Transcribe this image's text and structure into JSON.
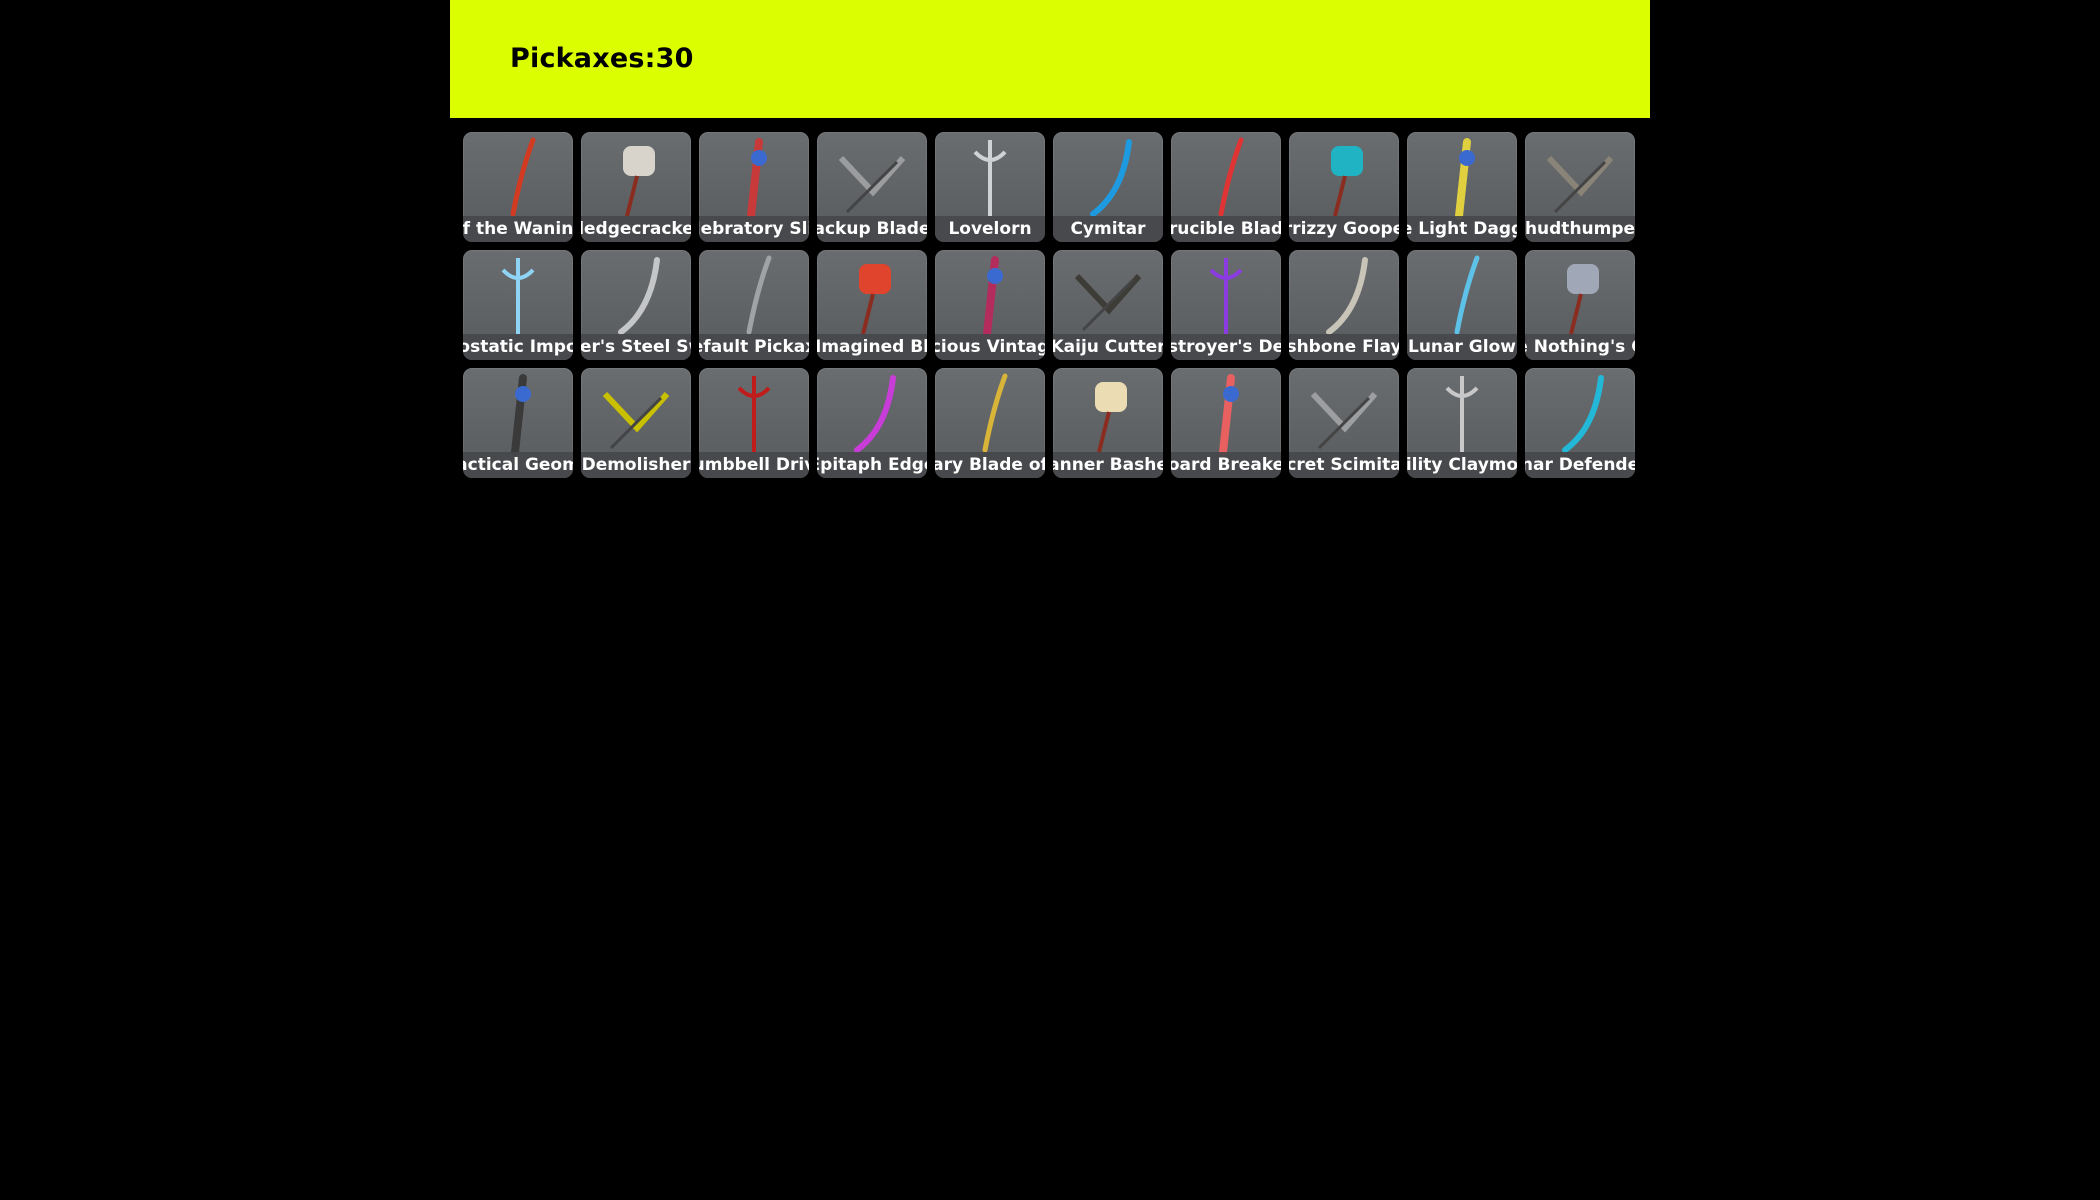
{
  "header": {
    "title": "Pickaxes:30"
  },
  "colors": {
    "header_bg": "#dbff00",
    "page_bg": "#000000",
    "tile_bg": "#5f6265"
  },
  "items": [
    {
      "label": "f the Wanin",
      "icon": "red-scythe-blade-icon",
      "color": "#d23a22"
    },
    {
      "label": "ledgecracke",
      "icon": "sledgehammer-icon",
      "color": "#d8d4cc"
    },
    {
      "label": "lebratory Sli",
      "icon": "confetti-popper-icon",
      "color": "#c83a3a"
    },
    {
      "label": "ackup Blade",
      "icon": "crossed-axes-icon",
      "color": "#9a9c9e"
    },
    {
      "label": "Lovelorn",
      "icon": "silver-trident-icon",
      "color": "#d0d2d4"
    },
    {
      "label": "Cymitar",
      "icon": "blue-curved-blade-icon",
      "color": "#1e9be0"
    },
    {
      "label": "rucible Blad",
      "icon": "red-crystal-blade-icon",
      "color": "#e03434"
    },
    {
      "label": "rrizzy Goope",
      "icon": "spiked-mace-icon",
      "color": "#1fb3c4"
    },
    {
      "label": "e Light Dagg",
      "icon": "winged-daggers-icon",
      "color": "#e0d040"
    },
    {
      "label": "hudthumpe",
      "icon": "hooked-hammer-icon",
      "color": "#8a8478"
    },
    {
      "label": "ostatic Impo",
      "icon": "ice-spear-icon",
      "color": "#8fd4f4"
    },
    {
      "label": "her's Steel Sw",
      "icon": "steel-sword-icon",
      "color": "#c4c6c8"
    },
    {
      "label": "efault Pickax",
      "icon": "default-pickaxe-icon",
      "color": "#9fa3a6"
    },
    {
      "label": "Imagined Bl",
      "icon": "red-blade-icon",
      "color": "#e0442c"
    },
    {
      "label": "cious Vintag",
      "icon": "twin-masks-icon",
      "color": "#b42c5c"
    },
    {
      "label": "Kaiju Cutter",
      "icon": "bone-blade-icon",
      "color": "#3e3c36"
    },
    {
      "label": "stroyer's De",
      "icon": "purple-eye-axe-icon",
      "color": "#8a3ce0"
    },
    {
      "label": "shbone Flay",
      "icon": "fishbone-scythe-icon",
      "color": "#c8c4b8"
    },
    {
      "label": "Lunar Glow",
      "icon": "moon-axe-icon",
      "color": "#5ec2e8"
    },
    {
      "label": "e Nothing's C",
      "icon": "dark-spike-blade-icon",
      "color": "#a0a8b8"
    },
    {
      "label": "actical Geom",
      "icon": "v-blades-icon",
      "color": "#3a3a3a"
    },
    {
      "label": "Demolisher",
      "icon": "hazard-hammer-icon",
      "color": "#c8c000"
    },
    {
      "label": "umbbell Driv",
      "icon": "dumbbell-hammer-icon",
      "color": "#c01c1c"
    },
    {
      "label": "Epitaph Edge",
      "icon": "pink-sword-icon",
      "color": "#c83cd8"
    },
    {
      "label": "ary Blade of",
      "icon": "golden-sword-icon",
      "color": "#d8b438"
    },
    {
      "label": "anner Bashe",
      "icon": "moth-wings-icon",
      "color": "#ecdcb4"
    },
    {
      "label": "oard Breake",
      "icon": "surfboard-icon",
      "color": "#e86060"
    },
    {
      "label": "cret Scimita",
      "icon": "crescent-blades-icon",
      "color": "#9c9ea0"
    },
    {
      "label": "ility Claymo",
      "icon": "red-claymore-icon",
      "color": "#c8c8c8"
    },
    {
      "label": "nar Defende",
      "icon": "cyan-blade-icon",
      "color": "#24b8d8"
    }
  ]
}
